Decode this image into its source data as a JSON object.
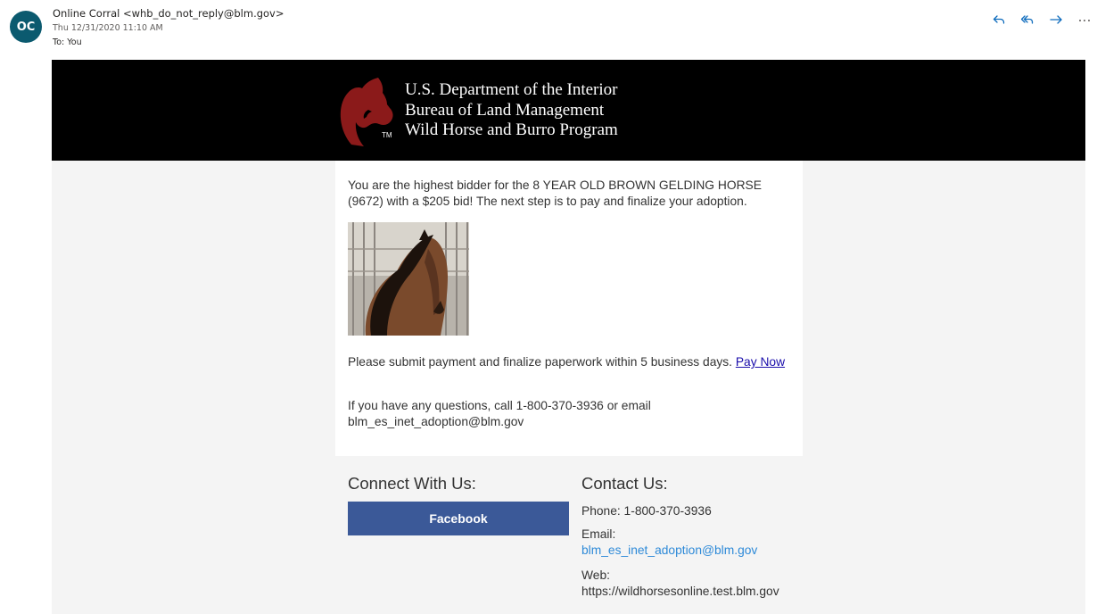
{
  "header": {
    "avatar_initials": "OC",
    "from": "Online Corral <whb_do_not_reply@blm.gov>",
    "date": "Thu 12/31/2020 11:10 AM",
    "to": "To: You",
    "actions": [
      {
        "name": "reply-icon"
      },
      {
        "name": "reply-all-icon"
      },
      {
        "name": "forward-icon"
      },
      {
        "name": "more-icon"
      }
    ]
  },
  "banner": {
    "line1": "U.S. Department of the Interior",
    "line2": "Bureau of Land Management",
    "line3": "Wild Horse and Burro Program",
    "tm": "TM",
    "logo_color": "#8b1a1a"
  },
  "body": {
    "message": "You are the highest bidder for the 8 YEAR OLD BROWN GELDING HORSE (9672) with a $205 bid! The next step is to pay and finalize your adoption.",
    "submit_text": "Please submit payment and finalize paperwork within 5 business days. ",
    "pay_link": "Pay Now",
    "questions": "If you have any questions, call 1-800-370-3936 or email blm_es_inet_adoption@blm.gov"
  },
  "footer": {
    "connect_heading": "Connect With Us:",
    "facebook_label": "Facebook",
    "contact_heading": "Contact Us:",
    "phone": "Phone: 1-800-370-3936",
    "email_label": "Email:",
    "email": "blm_es_inet_adoption@blm.gov",
    "web_label": "Web:",
    "web": "https://wildhorsesonline.test.blm.gov"
  },
  "colors": {
    "avatar_bg": "#0b5a6f",
    "accent_icons": "#0f6cbd",
    "facebook": "#3b5998",
    "link": "#2e8ad8"
  }
}
